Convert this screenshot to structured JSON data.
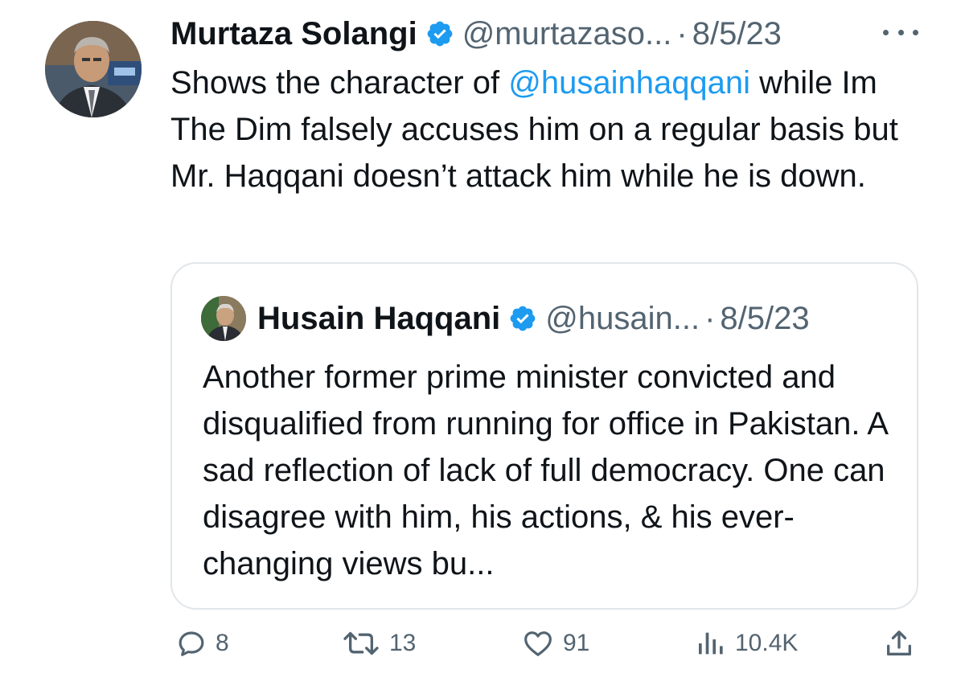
{
  "tweet": {
    "author_name": "Murtaza Solangi",
    "handle": "@murtazaso...",
    "separator": "·",
    "date": "8/5/23",
    "text_before_mention": "Shows the character of ",
    "mention": "@husainhaqqani",
    "text_after_mention": " while Im The Dim falsely accuses him on a regular basis but Mr. Haqqani doesn’t attack him while he is down."
  },
  "quoted_tweet": {
    "author_name": "Husain Haqqani",
    "handle": "@husain...",
    "separator": "·",
    "date": "8/5/23",
    "text": "Another former prime minister convicted and disqualified from running for office in Pakistan. A sad reflection of lack of full democracy. One can disagree with him, his actions, & his ever-changing views bu..."
  },
  "actions": {
    "replies": "8",
    "retweets": "13",
    "likes": "91",
    "views": "10.4K"
  },
  "colors": {
    "text": "#0f1419",
    "secondary": "#536471",
    "link": "#1d9bf0",
    "verified": "#1d9bf0",
    "border": "#e1e6ea"
  },
  "icons": [
    "verified-badge-icon",
    "more-icon",
    "reply-icon",
    "retweet-icon",
    "like-icon",
    "views-icon",
    "share-icon"
  ]
}
